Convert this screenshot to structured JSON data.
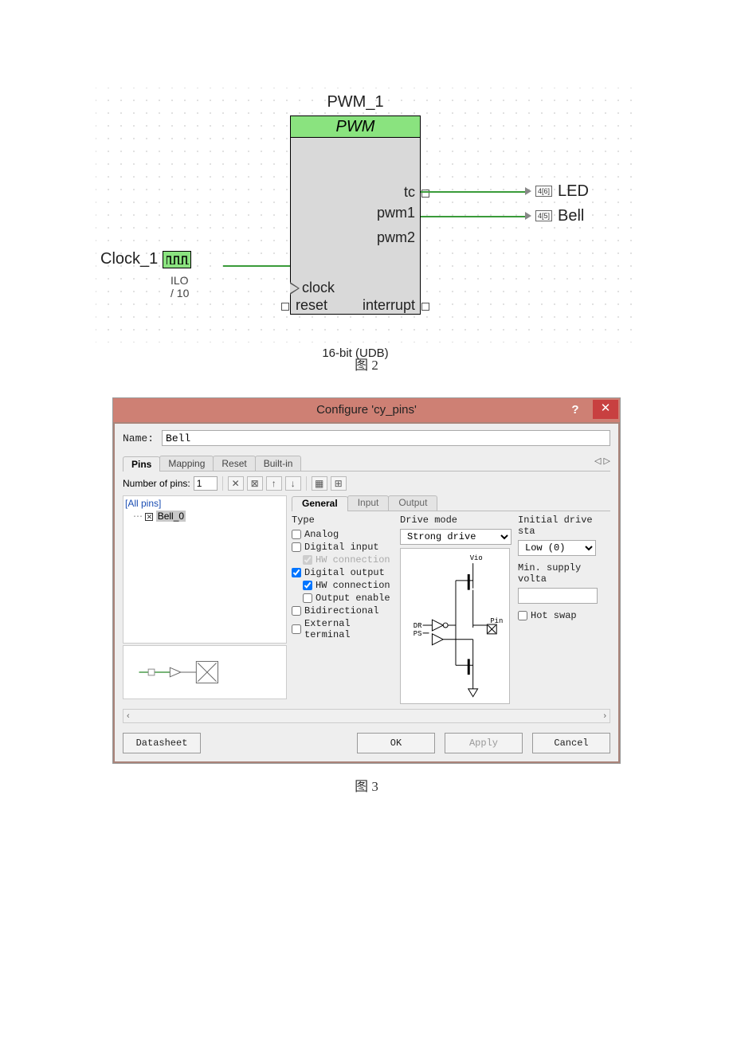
{
  "fig2": {
    "caption": "图 2",
    "pwm_name": "PWM_1",
    "pwm_header": "PWM",
    "ports": {
      "tc": "tc",
      "pwm1": "pwm1",
      "pwm2": "pwm2",
      "clock": "clock",
      "reset": "reset",
      "interrupt": "interrupt"
    },
    "footer": "16-bit (UDB)",
    "clock_name": "Clock_1",
    "clock_sub": "ILO / 10",
    "led_pin_idx": "4[6]",
    "led_lbl": "LED",
    "bell_pin_idx": "4[5]",
    "bell_lbl": "Bell"
  },
  "fig3": {
    "caption": "图 3",
    "title": "Configure 'cy_pins'",
    "name_label": "Name:",
    "name_value": "Bell",
    "tabs": {
      "pins": "Pins",
      "mapping": "Mapping",
      "reset": "Reset",
      "builtin": "Built-in"
    },
    "num_pins_label": "Number of pins:",
    "num_pins_value": "1",
    "all_pins": "[All pins]",
    "pin_item": "Bell_0",
    "subtabs": {
      "general": "General",
      "input": "Input",
      "output": "Output"
    },
    "type_header": "Type",
    "opts": {
      "analog": "Analog",
      "digital_input": "Digital input",
      "hw_conn1": "HW connection",
      "digital_output": "Digital output",
      "hw_conn2": "HW connection",
      "output_enable": "Output enable",
      "bidirectional": "Bidirectional",
      "external_terminal": "External terminal"
    },
    "drive_mode_label": "Drive mode",
    "drive_mode_value": "Strong drive",
    "drive_labels": {
      "vio": "Vio",
      "dr": "DR",
      "ps": "PS",
      "pin": "Pin"
    },
    "initial_label": "Initial drive sta",
    "initial_value": "Low (0)",
    "min_supply_label": "Min. supply volta",
    "hot_swap": "Hot swap",
    "buttons": {
      "datasheet": "Datasheet",
      "ok": "OK",
      "apply": "Apply",
      "cancel": "Cancel"
    }
  }
}
